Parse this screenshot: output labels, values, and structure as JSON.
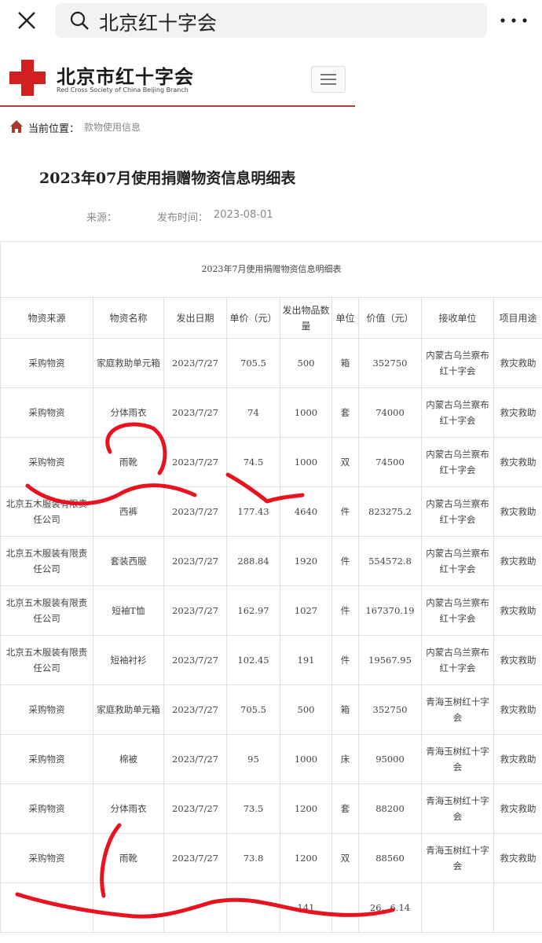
{
  "search": {
    "query": "北京红十字会"
  },
  "site": {
    "name_cn": "北京市红十字会",
    "name_en": "Red Cross Society of China Beijing Branch"
  },
  "breadcrumb": {
    "label": "当前位置：",
    "current": "款物使用信息"
  },
  "article": {
    "title": "2023年07月使用捐赠物资信息明细表",
    "source_label": "来源：",
    "publish_label": "发布时间：",
    "publish_date": "2023-08-01"
  },
  "table": {
    "caption": "2023年7月使用捐赠物资信息明细表",
    "headers": [
      "物资来源",
      "物资名称",
      "发出日期",
      "单价（元）",
      "发出物品数量",
      "单位",
      "价值（元）",
      "接收单位",
      "项目用途"
    ],
    "rows": [
      [
        "采购物资",
        "家庭救助单元箱",
        "2023/7/27",
        "705.5",
        "500",
        "箱",
        "352750",
        "内蒙古乌兰察布红十字会",
        "救灾救助"
      ],
      [
        "采购物资",
        "分体雨衣",
        "2023/7/27",
        "74",
        "1000",
        "套",
        "74000",
        "内蒙古乌兰察布红十字会",
        "救灾救助"
      ],
      [
        "采购物资",
        "雨靴",
        "2023/7/27",
        "74.5",
        "1000",
        "双",
        "74500",
        "内蒙古乌兰察布红十字会",
        "救灾救助"
      ],
      [
        "北京五木服装有限责任公司",
        "西裤",
        "2023/7/27",
        "177.43",
        "4640",
        "件",
        "823275.2",
        "内蒙古乌兰察布红十字会",
        "救灾救助"
      ],
      [
        "北京五木服装有限责任公司",
        "套装西服",
        "2023/7/27",
        "288.84",
        "1920",
        "件",
        "554572.8",
        "内蒙古乌兰察布红十字会",
        "救灾救助"
      ],
      [
        "北京五木服装有限责任公司",
        "短袖T恤",
        "2023/7/27",
        "162.97",
        "1027",
        "件",
        "167370.19",
        "内蒙古乌兰察布红十字会",
        "救灾救助"
      ],
      [
        "北京五木服装有限责任公司",
        "短袖衬衫",
        "2023/7/27",
        "102.45",
        "191",
        "件",
        "19567.95",
        "内蒙古乌兰察布红十字会",
        "救灾救助"
      ],
      [
        "采购物资",
        "家庭救助单元箱",
        "2023/7/27",
        "705.5",
        "500",
        "箱",
        "352750",
        "青海玉树红十字会",
        "救灾救助"
      ],
      [
        "采购物资",
        "棉被",
        "2023/7/27",
        "95",
        "1000",
        "床",
        "95000",
        "青海玉树红十字会",
        "救灾救助"
      ],
      [
        "采购物资",
        "分体雨衣",
        "2023/7/27",
        "73.5",
        "1200",
        "套",
        "88200",
        "青海玉树红十字会",
        "救灾救助"
      ],
      [
        "采购物资",
        "雨靴",
        "2023/7/27",
        "73.8",
        "1200",
        "双",
        "88560",
        "青海玉树红十字会",
        "救灾救助"
      ]
    ],
    "total_row": [
      "",
      "",
      "",
      "",
      "141",
      "",
      "26...6.14",
      "",
      ""
    ]
  },
  "colors": {
    "brand_red": "#d21f1f",
    "scribble_red": "#e8131f",
    "rule": "#b53a3a"
  }
}
